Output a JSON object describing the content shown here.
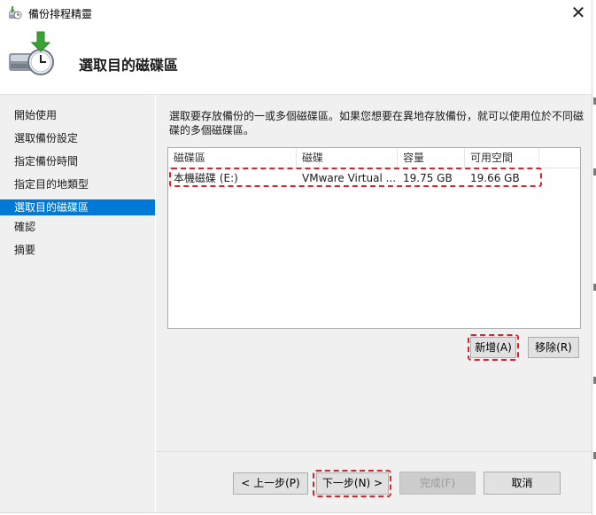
{
  "window": {
    "title": "備份排程精靈",
    "close_glyph": "✕"
  },
  "header": {
    "title": "選取目的磁碟區",
    "icon": "backup-disk-clock-icon"
  },
  "nav": {
    "items": [
      {
        "label": "開始使用"
      },
      {
        "label": "選取備份設定"
      },
      {
        "label": "指定備份時間"
      },
      {
        "label": "指定目的地類型"
      },
      {
        "label": "選取目的磁碟區",
        "active": true
      },
      {
        "label": "確認"
      },
      {
        "label": "摘要"
      }
    ]
  },
  "content": {
    "description": "選取要存放備份的一或多個磁碟區。如果您想要在異地存放備份，就可以使用位於不同磁碟的多個磁碟區。",
    "columns": [
      "磁碟區",
      "磁碟",
      "容量",
      "可用空間"
    ],
    "rows": [
      {
        "volume": "本機磁碟 (E:)",
        "disk": "VMware Virtual ...",
        "capacity": "19.75 GB",
        "free": "19.66 GB"
      }
    ],
    "add_label": "新增(A)",
    "remove_label": "移除(R)"
  },
  "footer": {
    "back_label": "< 上一步(P)",
    "next_label": "下一步(N) >",
    "finish_label": "完成(F)",
    "cancel_label": "取消"
  },
  "colors": {
    "selection": "#0078d7",
    "annotation": "#e0202a",
    "panel": "#f0f0f0"
  }
}
